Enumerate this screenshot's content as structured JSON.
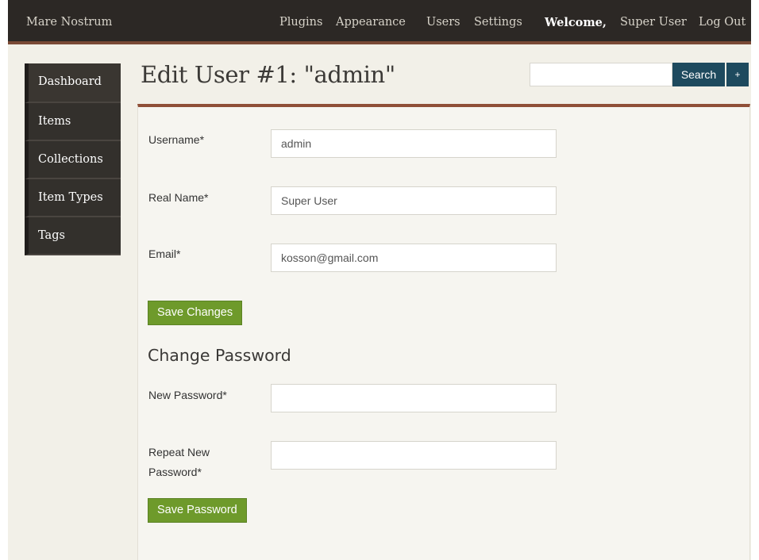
{
  "topbar": {
    "site_title": "Mare Nostrum",
    "nav": [
      "Plugins",
      "Appearance",
      "Users",
      "Settings"
    ],
    "welcome_label": "Welcome,",
    "user_name": "Super User",
    "logout_label": "Log Out"
  },
  "sidebar": {
    "items": [
      {
        "label": "Dashboard"
      },
      {
        "label": "Items"
      },
      {
        "label": "Collections"
      },
      {
        "label": "Item Types"
      },
      {
        "label": "Tags"
      }
    ]
  },
  "page": {
    "title": "Edit User #1: \"admin\""
  },
  "search": {
    "button_label": "Search",
    "advanced_label": "+"
  },
  "form": {
    "username_label": "Username*",
    "username_value": "admin",
    "realname_label": "Real Name*",
    "realname_value": "Super User",
    "email_label": "Email*",
    "email_value": "kosson@gmail.com",
    "save_changes_label": "Save Changes",
    "change_password_heading": "Change Password",
    "new_password_label": "New Password*",
    "new_password_value": "",
    "repeat_password_label_line1": "Repeat New",
    "repeat_password_label_line2": "Password*",
    "repeat_password_value": "",
    "save_password_label": "Save Password"
  },
  "colors": {
    "topbar_bg": "#2c2825",
    "accent_rust": "#8f4f37",
    "button_green": "#6e9a2b",
    "search_blue": "#1e4a5e",
    "sidebar_bg": "#33302c",
    "page_bg": "#f2f0e8"
  }
}
